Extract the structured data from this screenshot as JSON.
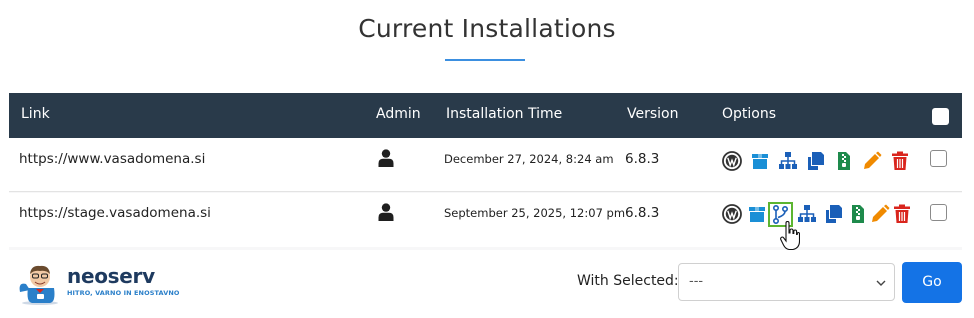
{
  "page_title": "Current Installations",
  "table": {
    "headers": {
      "link": "Link",
      "admin": "Admin",
      "installation_time": "Installation Time",
      "version": "Version",
      "options": "Options"
    },
    "rows": [
      {
        "link": "https://www.vasadomena.si",
        "installation_time": "December 27, 2024, 8:24 am",
        "version": "6.8.3",
        "options": [
          "wordpress-icon",
          "backup-box-icon",
          "sitemap-icon",
          "clone-icon",
          "archive-icon",
          "edit-pencil-icon",
          "trash-icon"
        ]
      },
      {
        "link": "https://stage.vasadomena.si",
        "installation_time": "September 25, 2025, 12:07 pm",
        "version": "6.8.3",
        "options": [
          "wordpress-icon",
          "backup-box-icon",
          "git-branch-icon",
          "sitemap-icon",
          "clone-icon",
          "archive-icon",
          "edit-pencil-icon",
          "trash-icon"
        ]
      }
    ]
  },
  "footer": {
    "brand": "neoserv",
    "tagline": "HITRO, VARNO IN ENOSTAVNO",
    "with_selected_label": "With Selected:",
    "select_value": "---",
    "go_label": "Go"
  },
  "colors": {
    "header_bg": "#293a4a",
    "accent_blue": "#1473e6",
    "icon_blue": "#1a8fd6",
    "icon_dark_blue": "#1a5fb8",
    "icon_green": "#1e8a4c",
    "icon_orange": "#f08a00",
    "icon_red": "#d9251d",
    "highlight_green": "#5cb531"
  }
}
